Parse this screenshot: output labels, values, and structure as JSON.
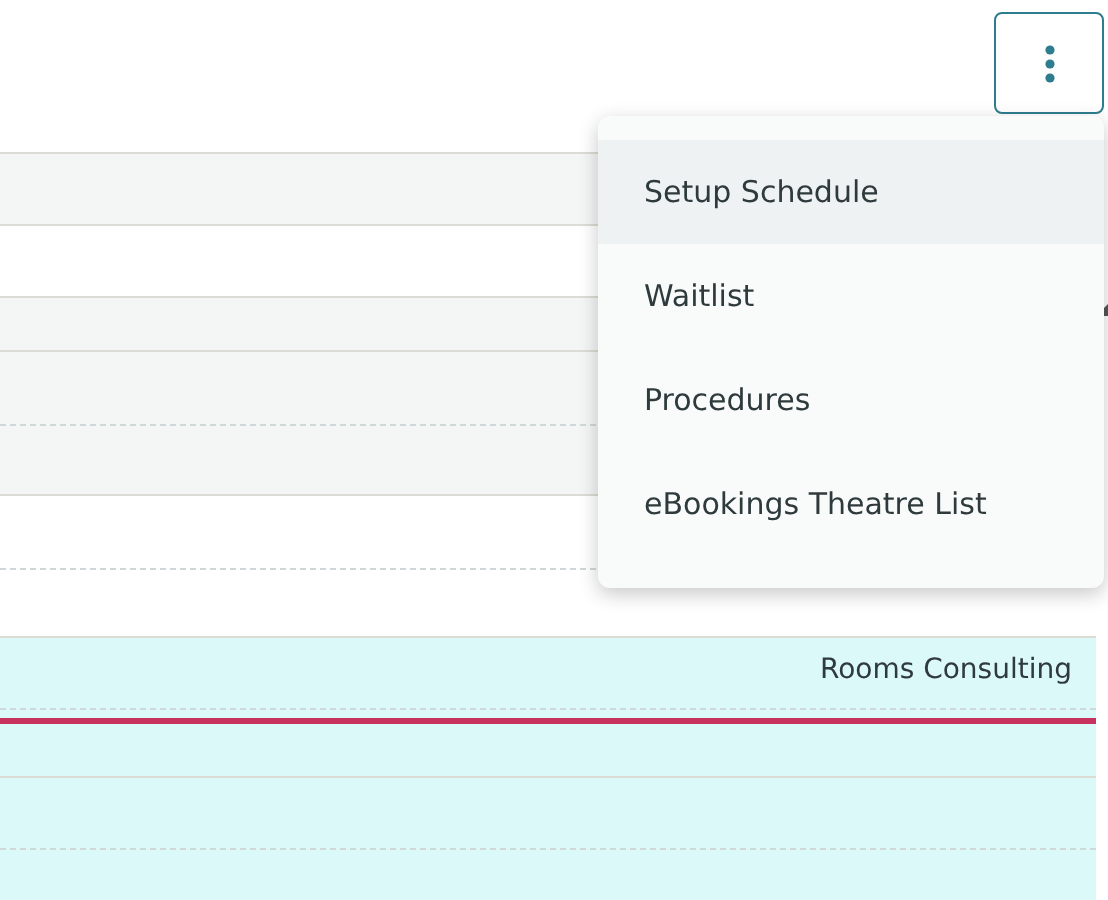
{
  "menu_button": {
    "expanded": true
  },
  "menu": {
    "items": [
      {
        "label": "Setup Schedule",
        "selected": true
      },
      {
        "label": "Waitlist",
        "selected": false
      },
      {
        "label": "Procedures",
        "selected": false
      },
      {
        "label": "eBookings Theatre List",
        "selected": false
      }
    ]
  },
  "resource_band": {
    "label": "Rooms Consulting"
  }
}
